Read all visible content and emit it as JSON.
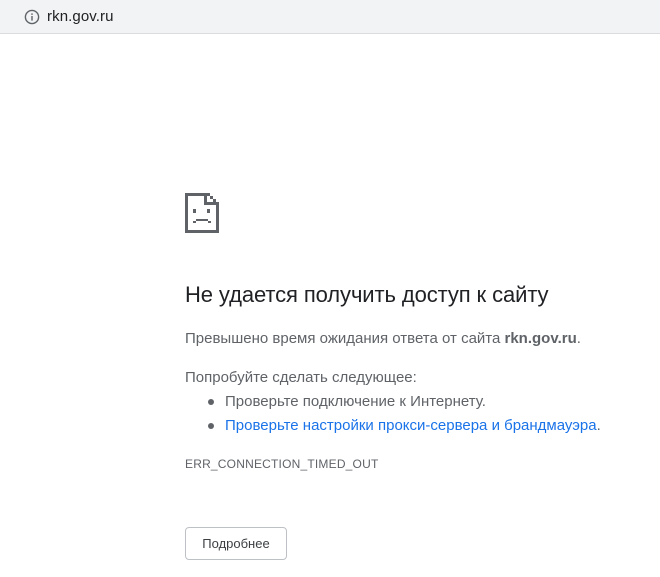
{
  "address_bar": {
    "url": "rkn.gov.ru",
    "icon": "info-icon"
  },
  "error_page": {
    "icon": "sad-page-icon",
    "heading": "Не удается получить доступ к сайту",
    "summary_prefix": "Превышено время ожидания ответа от сайта ",
    "summary_host": "rkn.gov.ru",
    "summary_suffix": ".",
    "try_heading": "Попробуйте сделать следующее:",
    "suggestions": [
      {
        "text": "Проверьте подключение к Интернету.",
        "suffix": ""
      },
      {
        "text": "Проверьте настройки прокси-сервера и брандмауэра",
        "suffix": "."
      }
    ],
    "error_code": "ERR_CONNECTION_TIMED_OUT",
    "details_button_label": "Подробнее"
  },
  "colors": {
    "link": "#1a73e8",
    "text_secondary": "#5f6368",
    "heading": "#202124"
  }
}
